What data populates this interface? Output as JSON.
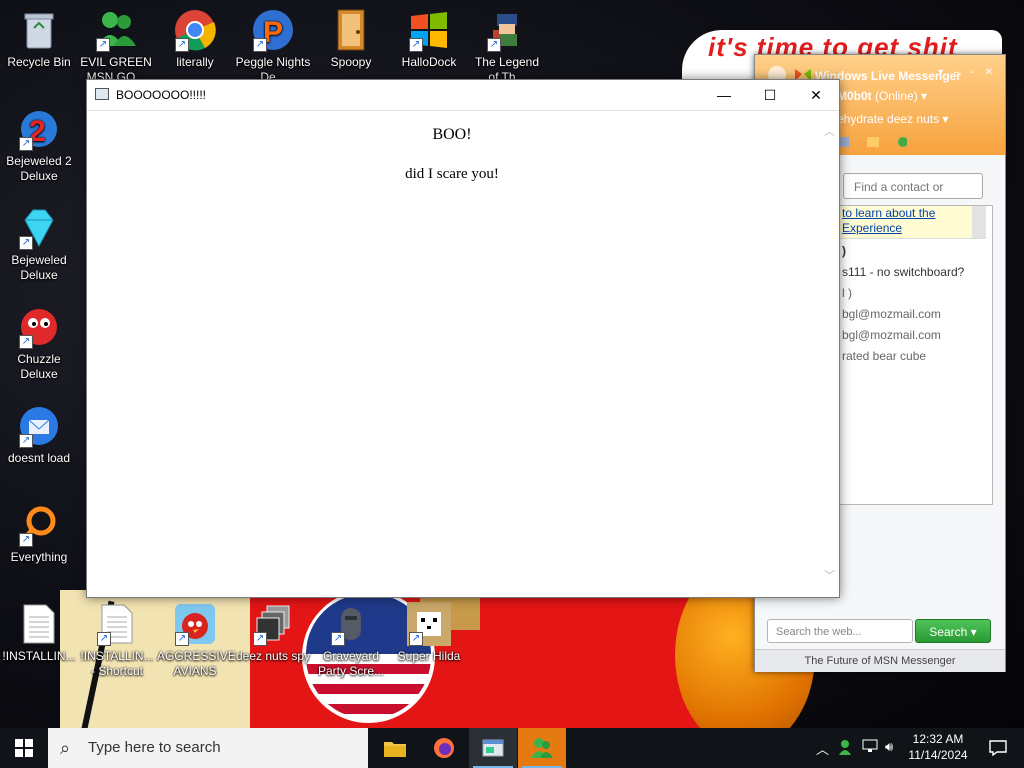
{
  "wallpaper": {
    "tagline": "it's time to get shit"
  },
  "desktop": {
    "icons": [
      {
        "label": "Recycle Bin",
        "icon": "recycle-bin-icon"
      },
      {
        "label": "EVIL GREEN MSN GO...",
        "icon": "msn-buddy-icon"
      },
      {
        "label": "literally",
        "icon": "chrome-icon"
      },
      {
        "label": "Peggle Nights De...",
        "icon": "peggle-icon"
      },
      {
        "label": "Spoopy",
        "icon": "door-icon"
      },
      {
        "label": "HalloDock",
        "icon": "windows-logo-icon"
      },
      {
        "label": "The Legend of Th...",
        "icon": "pixel-character-icon"
      },
      {
        "label": "Bejeweled 2 Deluxe",
        "icon": "bejeweled2-icon"
      },
      {
        "label": "Bejeweled Deluxe",
        "icon": "diamond-icon"
      },
      {
        "label": "Chuzzle Deluxe",
        "icon": "chuzzle-icon"
      },
      {
        "label": "doesnt load",
        "icon": "thunderbird-icon"
      },
      {
        "label": "Everything",
        "icon": "magnifier-icon"
      },
      {
        "label": "!INSTALLIN...",
        "icon": "text-file-icon"
      },
      {
        "label": "!INSTALLIN... - Shortcut",
        "icon": "text-file-icon"
      },
      {
        "label": "AGGRESSIVE AVIANS",
        "icon": "angry-bird-icon"
      },
      {
        "label": "deez nuts spy",
        "icon": "windows-stack-icon"
      },
      {
        "label": "Graveyard Party Scre...",
        "icon": "graveyard-icon"
      },
      {
        "label": "Super Hilda",
        "icon": "pixel-dog-icon"
      }
    ]
  },
  "main_window": {
    "title": "BOOOOOOO!!!!!",
    "heading": "BOO!",
    "message": "did I scare you!",
    "controls": {
      "minimize": "—",
      "maximize": "☐",
      "close": "✕"
    }
  },
  "msn": {
    "title": "Windows Live Messenger",
    "username": "M0b0t",
    "status": "(Online)",
    "psm": "ehydrate deez nuts",
    "find_placeholder": "Find a contact or numbe",
    "ad_line1": "to learn about the",
    "ad_line2": "Experience",
    "contacts": [
      ")",
      "s111 - no switchboard?",
      "l )",
      "bgl@mozmail.com",
      "bgl@mozmail.com",
      "rated bear cube"
    ],
    "search_placeholder": "Search the web...",
    "search_button": "Search",
    "footer": "The Future of MSN Messenger"
  },
  "taskbar": {
    "search_text": "Type here to search",
    "time": "12:32 AM",
    "date": "11/14/2024"
  }
}
